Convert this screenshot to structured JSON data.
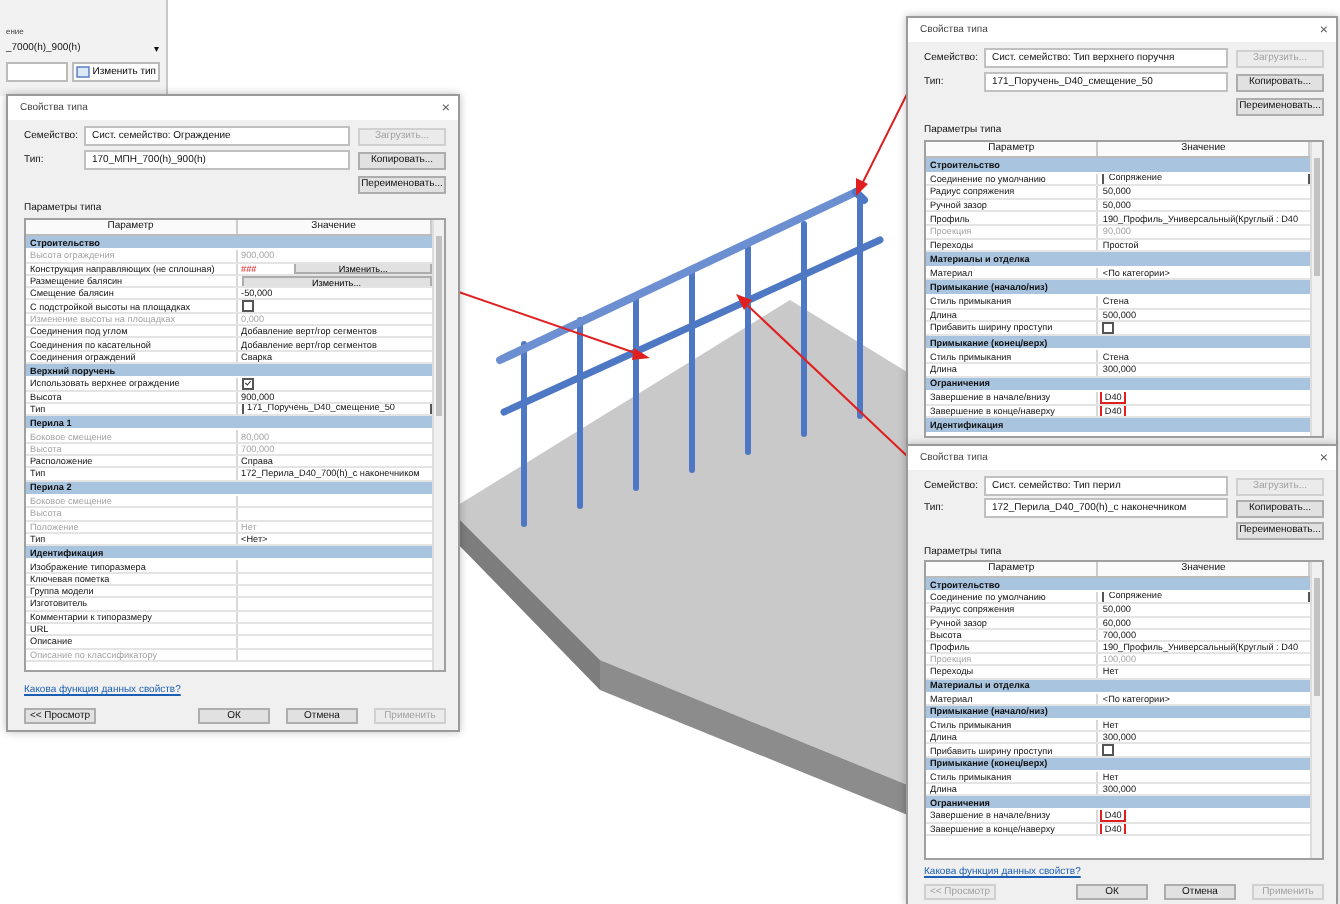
{
  "palette": {
    "label": "ение",
    "type": "_7000(h)_900(h)",
    "caret": "▾",
    "edit_type_button": "Изменить тип"
  },
  "dialogs": [
    {
      "title": "Свойства типа",
      "close": "×",
      "family_label": "Семейство:",
      "family": "Сист. семейство: Ограждение",
      "load_button": "Загрузить...",
      "type_label": "Тип:",
      "type": "170_МПН_700(h)_900(h)",
      "copy_button": "Копировать...",
      "rename_button": "Переименовать...",
      "params_label": "Параметры типа",
      "columns": [
        "Параметр",
        "Значение"
      ],
      "rows": [
        {
          "kind": "group",
          "name": "Строительство"
        },
        {
          "kind": "text",
          "name": "Высота ограждения",
          "value": "900,000",
          "disabled": true
        },
        {
          "kind": "button",
          "name": "Конструкция направляющих (не сплошная)",
          "note": "###",
          "button": "Изменить...",
          "disabled": false
        },
        {
          "kind": "button",
          "name": "Размещение балясин",
          "button": "Изменить...",
          "disabled": false
        },
        {
          "kind": "text",
          "name": "Смещение балясин",
          "value": "-50,000",
          "disabled": false
        },
        {
          "kind": "checkbox",
          "name": "С подстройкой высоты на площадках",
          "checked": false,
          "disabled": false
        },
        {
          "kind": "text",
          "name": "Изменение высоты на площадках",
          "value": "0,000",
          "disabled": true
        },
        {
          "kind": "text",
          "name": "Соединения под углом",
          "value": "Добавление верт/гор сегментов",
          "disabled": false
        },
        {
          "kind": "text",
          "name": "Соединения по касательной",
          "value": "Добавление верт/гор сегментов",
          "disabled": false
        },
        {
          "kind": "text",
          "name": "Соединения ограждений",
          "value": "Сварка",
          "disabled": false
        },
        {
          "kind": "group",
          "name": "Верхний поручень"
        },
        {
          "kind": "checkbox",
          "name": "Использовать верхнее ограждение",
          "checked": true,
          "disabled": false
        },
        {
          "kind": "text",
          "name": "Высота",
          "value": "900,000",
          "disabled": false
        },
        {
          "kind": "field",
          "name": "Тип",
          "value": "171_Поручень_D40_смещение_50",
          "disabled": false
        },
        {
          "kind": "group",
          "name": "Перила 1"
        },
        {
          "kind": "text",
          "name": "Боковое смещение",
          "value": "80,000",
          "disabled": true
        },
        {
          "kind": "text",
          "name": "Высота",
          "value": "700,000",
          "disabled": true
        },
        {
          "kind": "text",
          "name": "Расположение",
          "value": "Справа",
          "disabled": false
        },
        {
          "kind": "text",
          "name": "Тип",
          "value": "172_Перила_D40_700(h)_с наконечником",
          "disabled": false
        },
        {
          "kind": "group",
          "name": "Перила 2"
        },
        {
          "kind": "text",
          "name": "Боковое смещение",
          "disabled": true
        },
        {
          "kind": "text",
          "name": "Высота",
          "disabled": true
        },
        {
          "kind": "text",
          "name": "Положение",
          "value": "Нет",
          "disabled": true
        },
        {
          "kind": "text",
          "name": "Тип",
          "value": "<Нет>",
          "disabled": false
        },
        {
          "kind": "group",
          "name": "Идентификация"
        },
        {
          "kind": "text",
          "name": "Изображение типоразмера",
          "disabled": false
        },
        {
          "kind": "text",
          "name": "Ключевая пометка",
          "disabled": false
        },
        {
          "kind": "text",
          "name": "Группа модели",
          "disabled": false
        },
        {
          "kind": "text",
          "name": "Изготовитель",
          "disabled": false
        },
        {
          "kind": "text",
          "name": "Комментарии к типоразмеру",
          "disabled": false
        },
        {
          "kind": "text",
          "name": "URL",
          "disabled": false
        },
        {
          "kind": "text",
          "name": "Описание",
          "disabled": false
        },
        {
          "kind": "text",
          "name": "Описание по классификатору",
          "disabled": true
        }
      ],
      "footer": {
        "link": "Какова функция данных свойств?",
        "buttons": [
          {
            "label": "<< Просмотр",
            "disabled": false
          },
          {
            "label": "ОК",
            "disabled": false
          },
          {
            "label": "Отмена",
            "disabled": false
          },
          {
            "label": "Применить",
            "disabled": true
          }
        ]
      }
    },
    {
      "title": "Свойства типа",
      "close": "×",
      "family_label": "Семейство:",
      "family": "Сист. семейство: Тип верхнего поручня",
      "load_button": "Загрузить...",
      "type_label": "Тип:",
      "type": "171_Поручень_D40_смещение_50",
      "copy_button": "Копировать...",
      "rename_button": "Переименовать...",
      "params_label": "Параметры типа",
      "columns": [
        "Параметр",
        "Значение"
      ],
      "rows": [
        {
          "kind": "group",
          "name": "Строительство"
        },
        {
          "kind": "field",
          "name": "Соединение по умолчанию",
          "value": "Сопряжение",
          "disabled": false
        },
        {
          "kind": "text",
          "name": "Радиус сопряжения",
          "value": "50,000",
          "disabled": false
        },
        {
          "kind": "text",
          "name": "Ручной зазор",
          "value": "50,000",
          "disabled": false
        },
        {
          "kind": "text",
          "name": "Профиль",
          "value": "190_Профиль_Универсальный(Круглый : D40",
          "disabled": false
        },
        {
          "kind": "text",
          "name": "Проекция",
          "value": "90,000",
          "disabled": true
        },
        {
          "kind": "text",
          "name": "Переходы",
          "value": "Простой",
          "disabled": false
        },
        {
          "kind": "group",
          "name": "Материалы и отделка"
        },
        {
          "kind": "text",
          "name": "Материал",
          "value": "<По категории>",
          "disabled": false
        },
        {
          "kind": "group",
          "name": "Примыкание (начало/низ)"
        },
        {
          "kind": "text",
          "name": "Стиль примыкания",
          "value": "Стена",
          "disabled": false
        },
        {
          "kind": "text",
          "name": "Длина",
          "value": "500,000",
          "disabled": false
        },
        {
          "kind": "checkbox",
          "name": "Прибавить ширину проступи",
          "checked": false,
          "disabled": false
        },
        {
          "kind": "group",
          "name": "Примыкание (конец/верх)"
        },
        {
          "kind": "text",
          "name": "Стиль примыкания",
          "value": "Стена",
          "disabled": false
        },
        {
          "kind": "text",
          "name": "Длина",
          "value": "300,000",
          "disabled": false
        },
        {
          "kind": "group",
          "name": "Ограничения"
        },
        {
          "kind": "highlight",
          "name": "Завершение в начале/внизу",
          "value": "D40",
          "disabled": false
        },
        {
          "kind": "highlight",
          "name": "Завершение в конце/наверху",
          "value": "D40",
          "disabled": false
        },
        {
          "kind": "group",
          "name": "Идентификация"
        }
      ]
    },
    {
      "title": "Свойства типа",
      "close": "×",
      "family_label": "Семейство:",
      "family": "Сист. семейство: Тип перил",
      "load_button": "Загрузить...",
      "type_label": "Тип:",
      "type": "172_Перила_D40_700(h)_с наконечником",
      "copy_button": "Копировать...",
      "rename_button": "Переименовать...",
      "params_label": "Параметры типа",
      "columns": [
        "Параметр",
        "Значение"
      ],
      "rows": [
        {
          "kind": "group",
          "name": "Строительство"
        },
        {
          "kind": "field",
          "name": "Соединение по умолчанию",
          "value": "Сопряжение",
          "disabled": false
        },
        {
          "kind": "text",
          "name": "Радиус сопряжения",
          "value": "50,000",
          "disabled": false
        },
        {
          "kind": "text",
          "name": "Ручной зазор",
          "value": "60,000",
          "disabled": false
        },
        {
          "kind": "text",
          "name": "Высота",
          "value": "700,000",
          "disabled": false
        },
        {
          "kind": "text",
          "name": "Профиль",
          "value": "190_Профиль_Универсальный(Круглый : D40",
          "disabled": false
        },
        {
          "kind": "text",
          "name": "Проекция",
          "value": "100,000",
          "disabled": true
        },
        {
          "kind": "text",
          "name": "Переходы",
          "value": "Нет",
          "disabled": false
        },
        {
          "kind": "group",
          "name": "Материалы и отделка"
        },
        {
          "kind": "text",
          "name": "Материал",
          "value": "<По категории>",
          "disabled": false
        },
        {
          "kind": "group",
          "name": "Примыкание (начало/низ)"
        },
        {
          "kind": "text",
          "name": "Стиль примыкания",
          "value": "Нет",
          "disabled": false
        },
        {
          "kind": "text",
          "name": "Длина",
          "value": "300,000",
          "disabled": false
        },
        {
          "kind": "checkbox",
          "name": "Прибавить ширину проступи",
          "checked": false,
          "disabled": false
        },
        {
          "kind": "group",
          "name": "Примыкание (конец/верх)"
        },
        {
          "kind": "text",
          "name": "Стиль примыкания",
          "value": "Нет",
          "disabled": false
        },
        {
          "kind": "text",
          "name": "Длина",
          "value": "300,000",
          "disabled": false
        },
        {
          "kind": "group",
          "name": "Ограничения"
        },
        {
          "kind": "highlight",
          "name": "Завершение в начале/внизу",
          "value": "D40",
          "disabled": false
        },
        {
          "kind": "highlight",
          "name": "Завершение в конце/наверху",
          "value": "D40",
          "disabled": false
        }
      ],
      "footer": {
        "link": "Какова функция данных свойств?",
        "buttons": [
          {
            "label": "<< Просмотр",
            "disabled": true
          },
          {
            "label": "ОК",
            "disabled": false
          },
          {
            "label": "Отмена",
            "disabled": false
          },
          {
            "label": "Применить",
            "disabled": true
          }
        ]
      }
    }
  ]
}
